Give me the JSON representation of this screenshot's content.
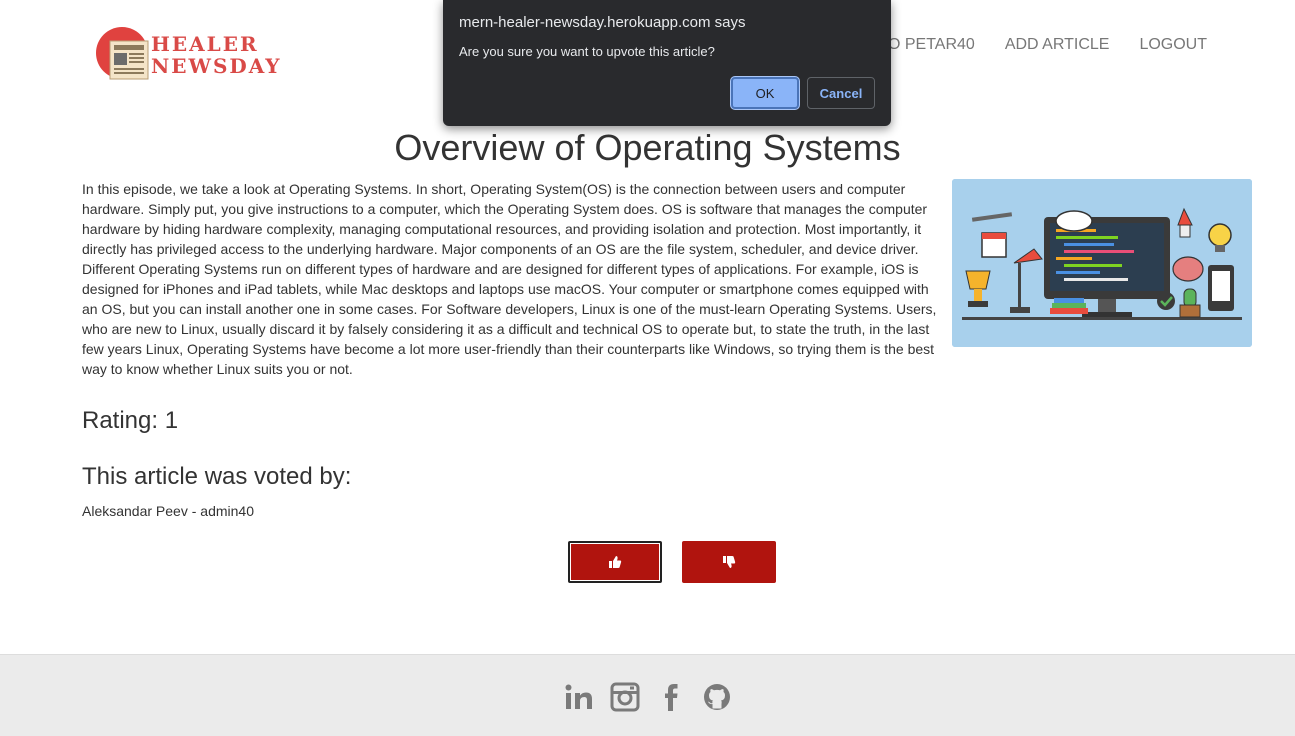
{
  "header": {
    "logo_line1": "HEALER",
    "logo_line2": "NEWSDAY",
    "nav": [
      {
        "label": "O PETAR40"
      },
      {
        "label": "ADD ARTICLE"
      },
      {
        "label": "LOGOUT"
      }
    ]
  },
  "article": {
    "title": "Overview of Operating Systems",
    "body": "In this episode, we take a look at Operating Systems. In short, Operating System(OS) is the connection between users and computer hardware. Simply put, you give instructions to a computer, which the Operating System does. OS is software that manages the computer hardware by hiding hardware complexity, managing computational resources, and providing isolation and protection. Most importantly, it directly has privileged access to the underlying hardware. Major components of an OS are the file system, scheduler, and device driver. Different Operating Systems run on different types of hardware and are designed for different types of applications. For example, iOS is designed for iPhones and iPad tablets, while Mac desktops and laptops use macOS. Your computer or smartphone comes equipped with an OS, but you can install another one in some cases. For Software developers, Linux is one of the must-learn Operating Systems. Users, who are new to Linux, usually discard it by falsely considering it as a difficult and technical OS to operate but, to state the truth, in the last few years Linux, Operating Systems have become a lot more user-friendly than their counterparts like Windows, so trying them is the best way to know whether Linux suits you or not.",
    "rating": "Rating: 1",
    "voted_heading": "This article was voted by:",
    "voters": [
      "Aleksandar Peev - admin40"
    ],
    "upvote_icon": "thumbs-up-icon",
    "downvote_icon": "thumbs-down-icon"
  },
  "footer": {
    "social": [
      "linkedin-icon",
      "instagram-icon",
      "facebook-icon",
      "github-icon"
    ]
  },
  "dialog": {
    "origin": "mern-healer-newsday.herokuapp.com says",
    "message": "Are you sure you want to upvote this article?",
    "ok_label": "OK",
    "cancel_label": "Cancel"
  },
  "colors": {
    "brand": "#d94a47",
    "vote_button": "#b0140e",
    "footer_bg": "#ebebeb",
    "dialog_bg": "#292a2d",
    "dialog_accent": "#8ab4f8"
  }
}
